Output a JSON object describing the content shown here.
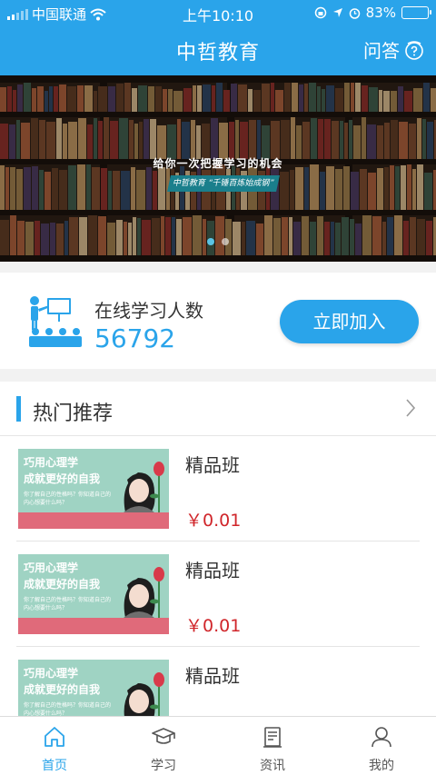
{
  "status_bar": {
    "carrier": "中国联通",
    "time": "上午10:10",
    "battery_pct": "83%",
    "battery_level": 0.83,
    "icons": [
      "signal-icon",
      "wifi-icon",
      "lock-rotation-icon",
      "location-icon",
      "alarm-icon",
      "battery-icon"
    ]
  },
  "header": {
    "title": "中哲教育",
    "qa_label": "问答",
    "qa_icon": "help-circle-icon",
    "background": "#2aa4ea"
  },
  "banner": {
    "headline": "给你一次把握学习的机会",
    "tagline": "中哲教育 “千锤百炼始成钢”",
    "slide_count": 2,
    "active_slide": 0
  },
  "learners": {
    "label": "在线学习人数",
    "count": "56792",
    "join_label": "立即加入",
    "icon": "classroom-icon"
  },
  "hot": {
    "title": "热门推荐",
    "courses": [
      {
        "name": "精品班",
        "price": "￥0.01",
        "thumb_line1": "巧用心理学",
        "thumb_line2": "成就更好的自我",
        "thumb_small": "你了解自己的性格吗？你知道自己的内心想要什么吗？"
      },
      {
        "name": "精品班",
        "price": "￥0.01",
        "thumb_line1": "巧用心理学",
        "thumb_line2": "成就更好的自我",
        "thumb_small": "你了解自己的性格吗？你知道自己的内心想要什么吗？"
      },
      {
        "name": "精品班",
        "price": "",
        "thumb_line1": "巧用心理学",
        "thumb_line2": "成就更好的自我",
        "thumb_small": "你了解自己的性格吗？你知道自己的内心想要什么吗？"
      }
    ]
  },
  "tabs": [
    {
      "label": "首页",
      "icon": "home-icon",
      "active": true
    },
    {
      "label": "学习",
      "icon": "graduation-cap-icon",
      "active": false
    },
    {
      "label": "资讯",
      "icon": "news-icon",
      "active": false
    },
    {
      "label": "我的",
      "icon": "user-icon",
      "active": false
    }
  ],
  "colors": {
    "accent": "#2aa4ea",
    "price": "#d0252a"
  }
}
